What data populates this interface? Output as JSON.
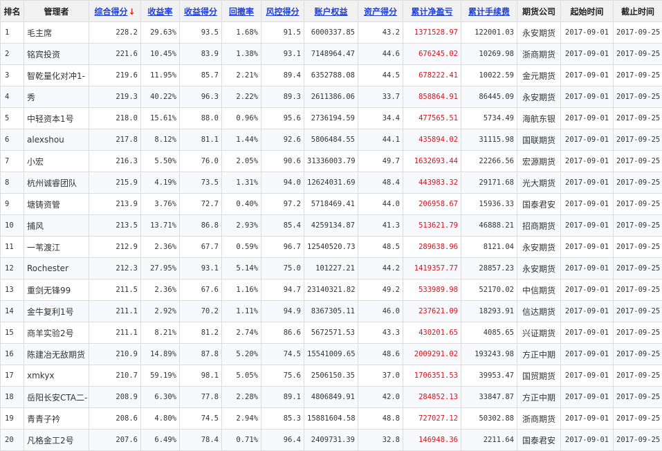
{
  "headers": {
    "rank": "排名",
    "manager": "管理者",
    "composite": "综合得分",
    "composite_arrow": "↓",
    "return_rate": "收益率",
    "return_score": "收益得分",
    "drawdown": "回撤率",
    "risk_score": "风控得分",
    "equity": "账户权益",
    "asset_score": "资产得分",
    "cum_pnl": "累计净盈亏",
    "cum_fee": "累计手续费",
    "futures_company": "期货公司",
    "start_time": "起始时间",
    "end_time": "截止时间"
  },
  "colors": {
    "header_link": "#1f3fd8",
    "sort_arrow": "#e0202a",
    "pnl_red": "#d4141c"
  },
  "rows": [
    {
      "rank": "1",
      "manager": "毛主席",
      "composite": "228.2",
      "return_rate": "29.63%",
      "return_score": "93.5",
      "drawdown": "1.68%",
      "risk_score": "91.5",
      "equity": "6000337.85",
      "asset_score": "43.2",
      "cum_pnl": "1371528.97",
      "cum_fee": "122001.03",
      "company": "永安期货",
      "start": "2017-09-01",
      "end": "2017-09-25"
    },
    {
      "rank": "2",
      "manager": "铭宾投资",
      "composite": "221.6",
      "return_rate": "10.45%",
      "return_score": "83.9",
      "drawdown": "1.38%",
      "risk_score": "93.1",
      "equity": "7148964.47",
      "asset_score": "44.6",
      "cum_pnl": "676245.02",
      "cum_fee": "10269.98",
      "company": "浙商期货",
      "start": "2017-09-01",
      "end": "2017-09-25"
    },
    {
      "rank": "3",
      "manager": "智乾量化对冲1-",
      "composite": "219.6",
      "return_rate": "11.95%",
      "return_score": "85.7",
      "drawdown": "2.21%",
      "risk_score": "89.4",
      "equity": "6352788.08",
      "asset_score": "44.5",
      "cum_pnl": "678222.41",
      "cum_fee": "10022.59",
      "company": "金元期货",
      "start": "2017-09-01",
      "end": "2017-09-25"
    },
    {
      "rank": "4",
      "manager": "秀",
      "composite": "219.3",
      "return_rate": "40.22%",
      "return_score": "96.3",
      "drawdown": "2.22%",
      "risk_score": "89.3",
      "equity": "2611386.06",
      "asset_score": "33.7",
      "cum_pnl": "858864.91",
      "cum_fee": "86445.09",
      "company": "永安期货",
      "start": "2017-09-01",
      "end": "2017-09-25"
    },
    {
      "rank": "5",
      "manager": "中轻资本1号",
      "composite": "218.0",
      "return_rate": "15.61%",
      "return_score": "88.0",
      "drawdown": "0.96%",
      "risk_score": "95.6",
      "equity": "2736194.59",
      "asset_score": "34.4",
      "cum_pnl": "477565.51",
      "cum_fee": "5734.49",
      "company": "海航东银",
      "start": "2017-09-01",
      "end": "2017-09-25"
    },
    {
      "rank": "6",
      "manager": "alexshou",
      "composite": "217.8",
      "return_rate": "8.12%",
      "return_score": "81.1",
      "drawdown": "1.44%",
      "risk_score": "92.6",
      "equity": "5806484.55",
      "asset_score": "44.1",
      "cum_pnl": "435894.02",
      "cum_fee": "31115.98",
      "company": "国联期货",
      "start": "2017-09-01",
      "end": "2017-09-25"
    },
    {
      "rank": "7",
      "manager": "小宏",
      "composite": "216.3",
      "return_rate": "5.50%",
      "return_score": "76.0",
      "drawdown": "2.05%",
      "risk_score": "90.6",
      "equity": "31336003.79",
      "asset_score": "49.7",
      "cum_pnl": "1632693.44",
      "cum_fee": "22266.56",
      "company": "宏源期货",
      "start": "2017-09-01",
      "end": "2017-09-25"
    },
    {
      "rank": "8",
      "manager": "杭州诚睿团队",
      "composite": "215.9",
      "return_rate": "4.19%",
      "return_score": "73.5",
      "drawdown": "1.31%",
      "risk_score": "94.0",
      "equity": "12624031.69",
      "asset_score": "48.4",
      "cum_pnl": "443983.32",
      "cum_fee": "29171.68",
      "company": "光大期货",
      "start": "2017-09-01",
      "end": "2017-09-25"
    },
    {
      "rank": "9",
      "manager": "塘铸资管",
      "composite": "213.9",
      "return_rate": "3.76%",
      "return_score": "72.7",
      "drawdown": "0.40%",
      "risk_score": "97.2",
      "equity": "5718469.41",
      "asset_score": "44.0",
      "cum_pnl": "206958.67",
      "cum_fee": "15936.33",
      "company": "国泰君安",
      "start": "2017-09-01",
      "end": "2017-09-25"
    },
    {
      "rank": "10",
      "manager": "捕风",
      "composite": "213.5",
      "return_rate": "13.71%",
      "return_score": "86.8",
      "drawdown": "2.93%",
      "risk_score": "85.4",
      "equity": "4259134.87",
      "asset_score": "41.3",
      "cum_pnl": "513621.79",
      "cum_fee": "46888.21",
      "company": "招商期货",
      "start": "2017-09-01",
      "end": "2017-09-25"
    },
    {
      "rank": "11",
      "manager": "一苇渡江",
      "composite": "212.9",
      "return_rate": "2.36%",
      "return_score": "67.7",
      "drawdown": "0.59%",
      "risk_score": "96.7",
      "equity": "12540520.73",
      "asset_score": "48.5",
      "cum_pnl": "289638.96",
      "cum_fee": "8121.04",
      "company": "永安期货",
      "start": "2017-09-01",
      "end": "2017-09-25"
    },
    {
      "rank": "12",
      "manager": "Rochester",
      "composite": "212.3",
      "return_rate": "27.95%",
      "return_score": "93.1",
      "drawdown": "5.14%",
      "risk_score": "75.0",
      "equity": "101227.21",
      "asset_score": "44.2",
      "cum_pnl": "1419357.77",
      "cum_fee": "28857.23",
      "company": "永安期货",
      "start": "2017-09-01",
      "end": "2017-09-25"
    },
    {
      "rank": "13",
      "manager": "重剑无锋99",
      "composite": "211.5",
      "return_rate": "2.36%",
      "return_score": "67.6",
      "drawdown": "1.16%",
      "risk_score": "94.7",
      "equity": "23140321.82",
      "asset_score": "49.2",
      "cum_pnl": "533989.98",
      "cum_fee": "52170.02",
      "company": "中信期货",
      "start": "2017-09-01",
      "end": "2017-09-25"
    },
    {
      "rank": "14",
      "manager": "金牛复利1号",
      "composite": "211.1",
      "return_rate": "2.92%",
      "return_score": "70.2",
      "drawdown": "1.11%",
      "risk_score": "94.9",
      "equity": "8367305.11",
      "asset_score": "46.0",
      "cum_pnl": "237621.09",
      "cum_fee": "18293.91",
      "company": "信达期货",
      "start": "2017-09-01",
      "end": "2017-09-25"
    },
    {
      "rank": "15",
      "manager": "商羊实验2号",
      "composite": "211.1",
      "return_rate": "8.21%",
      "return_score": "81.2",
      "drawdown": "2.74%",
      "risk_score": "86.6",
      "equity": "5672571.53",
      "asset_score": "43.3",
      "cum_pnl": "430201.65",
      "cum_fee": "4085.65",
      "company": "兴证期货",
      "start": "2017-09-01",
      "end": "2017-09-25"
    },
    {
      "rank": "16",
      "manager": "陈建冶无敌期货",
      "composite": "210.9",
      "return_rate": "14.89%",
      "return_score": "87.8",
      "drawdown": "5.20%",
      "risk_score": "74.5",
      "equity": "15541009.65",
      "asset_score": "48.6",
      "cum_pnl": "2009291.02",
      "cum_fee": "193243.98",
      "company": "方正中期",
      "start": "2017-09-01",
      "end": "2017-09-25"
    },
    {
      "rank": "17",
      "manager": "xmkyx",
      "composite": "210.7",
      "return_rate": "59.19%",
      "return_score": "98.1",
      "drawdown": "5.05%",
      "risk_score": "75.6",
      "equity": "2506150.35",
      "asset_score": "37.0",
      "cum_pnl": "1706351.53",
      "cum_fee": "39953.47",
      "company": "国贸期货",
      "start": "2017-09-01",
      "end": "2017-09-25"
    },
    {
      "rank": "18",
      "manager": "岳阳长安CTA二-",
      "composite": "208.9",
      "return_rate": "6.30%",
      "return_score": "77.8",
      "drawdown": "2.28%",
      "risk_score": "89.1",
      "equity": "4806849.91",
      "asset_score": "42.0",
      "cum_pnl": "284852.13",
      "cum_fee": "33847.87",
      "company": "方正中期",
      "start": "2017-09-01",
      "end": "2017-09-25"
    },
    {
      "rank": "19",
      "manager": "青青子衿",
      "composite": "208.6",
      "return_rate": "4.80%",
      "return_score": "74.5",
      "drawdown": "2.94%",
      "risk_score": "85.3",
      "equity": "15881604.58",
      "asset_score": "48.8",
      "cum_pnl": "727027.12",
      "cum_fee": "50302.88",
      "company": "浙商期货",
      "start": "2017-09-01",
      "end": "2017-09-25"
    },
    {
      "rank": "20",
      "manager": "凡格金工2号",
      "composite": "207.6",
      "return_rate": "6.49%",
      "return_score": "78.4",
      "drawdown": "0.71%",
      "risk_score": "96.4",
      "equity": "2409731.39",
      "asset_score": "32.8",
      "cum_pnl": "146948.36",
      "cum_fee": "2211.64",
      "company": "国泰君安",
      "start": "2017-09-01",
      "end": "2017-09-25"
    }
  ]
}
